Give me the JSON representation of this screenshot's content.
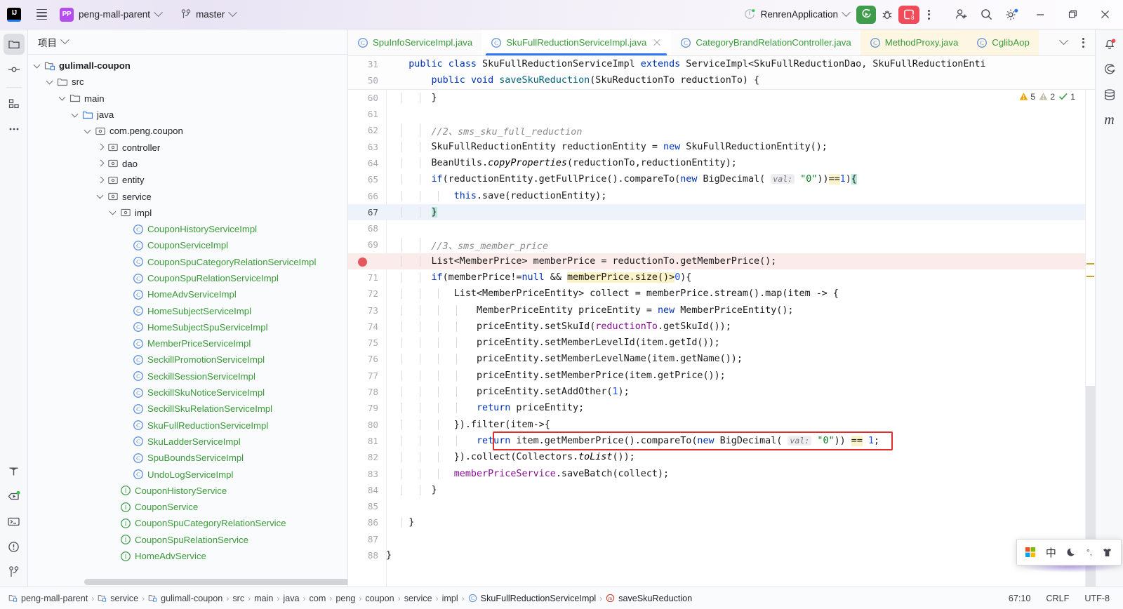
{
  "titlebar": {
    "logo": "IJ",
    "menu_icon": "hamburger-icon",
    "project_badge": "PP",
    "project_name": "peng-mall-parent",
    "branch_icon": "git-branch-icon",
    "branch_name": "master",
    "run_config": "RenrenApplication",
    "run_button": "run-icon",
    "debug_button": "debug-icon",
    "stop_button_count": "8",
    "more_button": "more-options-icon",
    "share_icon": "add-user-icon",
    "search_icon": "search-icon",
    "settings_icon": "gear-icon",
    "minimize": "minimize-icon",
    "maximize": "maximize-icon",
    "close": "close-icon"
  },
  "activitybar": {
    "items": [
      {
        "name": "project-tool-window",
        "icon": "folder-icon",
        "selected": true
      },
      {
        "name": "commit-tool-window",
        "icon": "commit-icon",
        "selected": false
      },
      {
        "name": "structure-tool-window",
        "icon": "structure-icon",
        "selected": false
      },
      {
        "name": "more-tool-windows",
        "icon": "ellipsis-icon",
        "selected": false
      }
    ],
    "bottom_items": [
      {
        "name": "build-tool-window",
        "icon": "hammer-icon"
      },
      {
        "name": "run-tool-window",
        "icon": "run-dashboard-icon"
      },
      {
        "name": "terminal-tool-window",
        "icon": "terminal-icon"
      },
      {
        "name": "problems-tool-window",
        "icon": "problems-icon"
      },
      {
        "name": "version-control-tool-window",
        "icon": "git-branch-icon"
      }
    ]
  },
  "project_panel": {
    "title": "项目",
    "title_chevron": "chevron-down-icon",
    "tree": [
      {
        "depth": 2,
        "label": "gulimall-coupon",
        "icon": "module-icon",
        "arrow": "down",
        "style": "bold"
      },
      {
        "depth": 3,
        "label": "src",
        "icon": "folder-icon",
        "arrow": "down",
        "style": "plain"
      },
      {
        "depth": 4,
        "label": "main",
        "icon": "folder-icon",
        "arrow": "down",
        "style": "plain"
      },
      {
        "depth": 5,
        "label": "java",
        "icon": "source-folder-icon",
        "arrow": "down",
        "style": "plain"
      },
      {
        "depth": 6,
        "label": "com.peng.coupon",
        "icon": "package-icon",
        "arrow": "down",
        "style": "plain"
      },
      {
        "depth": 7,
        "label": "controller",
        "icon": "package-icon",
        "arrow": "right",
        "style": "plain"
      },
      {
        "depth": 7,
        "label": "dao",
        "icon": "package-icon",
        "arrow": "right",
        "style": "plain"
      },
      {
        "depth": 7,
        "label": "entity",
        "icon": "package-icon",
        "arrow": "right",
        "style": "plain"
      },
      {
        "depth": 7,
        "label": "service",
        "icon": "package-icon",
        "arrow": "down",
        "style": "plain"
      },
      {
        "depth": 8,
        "label": "impl",
        "icon": "package-icon",
        "arrow": "down",
        "style": "plain"
      },
      {
        "depth": 9,
        "label": "CouponHistoryServiceImpl",
        "icon": "class-icon",
        "arrow": "none",
        "style": "class"
      },
      {
        "depth": 9,
        "label": "CouponServiceImpl",
        "icon": "class-icon",
        "arrow": "none",
        "style": "class"
      },
      {
        "depth": 9,
        "label": "CouponSpuCategoryRelationServiceImpl",
        "icon": "class-icon",
        "arrow": "none",
        "style": "class"
      },
      {
        "depth": 9,
        "label": "CouponSpuRelationServiceImpl",
        "icon": "class-icon",
        "arrow": "none",
        "style": "class"
      },
      {
        "depth": 9,
        "label": "HomeAdvServiceImpl",
        "icon": "class-icon",
        "arrow": "none",
        "style": "class"
      },
      {
        "depth": 9,
        "label": "HomeSubjectServiceImpl",
        "icon": "class-icon",
        "arrow": "none",
        "style": "class"
      },
      {
        "depth": 9,
        "label": "HomeSubjectSpuServiceImpl",
        "icon": "class-icon",
        "arrow": "none",
        "style": "class"
      },
      {
        "depth": 9,
        "label": "MemberPriceServiceImpl",
        "icon": "class-icon",
        "arrow": "none",
        "style": "class"
      },
      {
        "depth": 9,
        "label": "SeckillPromotionServiceImpl",
        "icon": "class-icon",
        "arrow": "none",
        "style": "class"
      },
      {
        "depth": 9,
        "label": "SeckillSessionServiceImpl",
        "icon": "class-icon",
        "arrow": "none",
        "style": "class"
      },
      {
        "depth": 9,
        "label": "SeckillSkuNoticeServiceImpl",
        "icon": "class-icon",
        "arrow": "none",
        "style": "class"
      },
      {
        "depth": 9,
        "label": "SeckillSkuRelationServiceImpl",
        "icon": "class-icon",
        "arrow": "none",
        "style": "class"
      },
      {
        "depth": 9,
        "label": "SkuFullReductionServiceImpl",
        "icon": "class-icon",
        "arrow": "none",
        "style": "class"
      },
      {
        "depth": 9,
        "label": "SkuLadderServiceImpl",
        "icon": "class-icon",
        "arrow": "none",
        "style": "class"
      },
      {
        "depth": 9,
        "label": "SpuBoundsServiceImpl",
        "icon": "class-icon",
        "arrow": "none",
        "style": "class"
      },
      {
        "depth": 9,
        "label": "UndoLogServiceImpl",
        "icon": "class-icon",
        "arrow": "none",
        "style": "class"
      },
      {
        "depth": 8,
        "label": "CouponHistoryService",
        "icon": "interface-icon",
        "arrow": "none",
        "style": "class"
      },
      {
        "depth": 8,
        "label": "CouponService",
        "icon": "interface-icon",
        "arrow": "none",
        "style": "class"
      },
      {
        "depth": 8,
        "label": "CouponSpuCategoryRelationService",
        "icon": "interface-icon",
        "arrow": "none",
        "style": "class"
      },
      {
        "depth": 8,
        "label": "CouponSpuRelationService",
        "icon": "interface-icon",
        "arrow": "none",
        "style": "class"
      },
      {
        "depth": 8,
        "label": "HomeAdvService",
        "icon": "interface-icon",
        "arrow": "none",
        "style": "class"
      }
    ]
  },
  "tabs": [
    {
      "label": "SpuInfoServiceImpl.java",
      "icon": "class-icon",
      "active": false,
      "warn": false,
      "closable": false
    },
    {
      "label": "SkuFullReductionServiceImpl.java",
      "icon": "class-icon",
      "active": true,
      "warn": false,
      "closable": true
    },
    {
      "label": "CategoryBrandRelationController.java",
      "icon": "class-icon",
      "active": false,
      "warn": false,
      "closable": false
    },
    {
      "label": "MethodProxy.java",
      "icon": "class-icon",
      "active": false,
      "warn": true,
      "closable": false
    },
    {
      "label": "CglibAop",
      "icon": "class-icon",
      "active": false,
      "warn": true,
      "closable": false
    }
  ],
  "tabbar_right": {
    "overflow_icon": "chevron-down-icon",
    "options_icon": "more-options-icon"
  },
  "inspections": {
    "warnings": "5",
    "weak_warnings": "2",
    "ok_count": "1",
    "warning_icon": "warning-triangle-icon",
    "weak_icon": "weak-warning-icon",
    "ok_icon": "inspection-ok-icon",
    "prev_icon": "chevron-up-icon",
    "next_icon": "chevron-down-icon"
  },
  "sticky_lines": [
    {
      "num": "31",
      "indent": 1,
      "tokens": [
        {
          "t": "public",
          "c": "kw"
        },
        {
          "t": " ",
          "c": ""
        },
        {
          "t": "class",
          "c": "kw"
        },
        {
          "t": " SkuFullReductionServiceImpl ",
          "c": ""
        },
        {
          "t": "extends",
          "c": "kw"
        },
        {
          "t": " ServiceImpl<SkuFullReductionDao, SkuFullReductionEnti",
          "c": ""
        }
      ]
    },
    {
      "num": "50",
      "indent": 2,
      "tokens": [
        {
          "t": "public",
          "c": "kw"
        },
        {
          "t": " ",
          "c": ""
        },
        {
          "t": "void",
          "c": "kw"
        },
        {
          "t": " ",
          "c": ""
        },
        {
          "t": "saveSkuReduction",
          "c": "mth"
        },
        {
          "t": "(SkuReductionTo reductionTo) {",
          "c": ""
        }
      ]
    }
  ],
  "code_lines": [
    {
      "num": "60",
      "guides": 2,
      "state": "normal",
      "tokens": [
        {
          "t": "        }",
          "c": ""
        }
      ]
    },
    {
      "num": "61",
      "guides": 2,
      "state": "normal",
      "tokens": [
        {
          "t": "",
          "c": ""
        }
      ]
    },
    {
      "num": "62",
      "guides": 2,
      "state": "normal",
      "tokens": [
        {
          "t": "        //2、sms_sku_full_reduction",
          "c": "cm"
        }
      ]
    },
    {
      "num": "63",
      "guides": 2,
      "state": "normal",
      "tokens": [
        {
          "t": "        SkuFullReductionEntity reductionEntity = ",
          "c": ""
        },
        {
          "t": "new",
          "c": "kw"
        },
        {
          "t": " SkuFullReductionEntity();",
          "c": ""
        }
      ]
    },
    {
      "num": "64",
      "guides": 2,
      "state": "normal",
      "tokens": [
        {
          "t": "        BeanUtils.",
          "c": ""
        },
        {
          "t": "copyProperties",
          "c": "stat"
        },
        {
          "t": "(reductionTo,reductionEntity);",
          "c": ""
        }
      ]
    },
    {
      "num": "65",
      "guides": 2,
      "state": "normal",
      "tokens": [
        {
          "t": "        ",
          "c": ""
        },
        {
          "t": "if",
          "c": "kw"
        },
        {
          "t": "(reductionEntity.getFullPrice().compareTo(",
          "c": ""
        },
        {
          "t": "new",
          "c": "kw"
        },
        {
          "t": " BigDecimal( ",
          "c": ""
        },
        {
          "t": "val:",
          "c": "param"
        },
        {
          "t": " ",
          "c": ""
        },
        {
          "t": "\"0\"",
          "c": "st"
        },
        {
          "t": "))",
          "c": ""
        },
        {
          "t": "==",
          "c": "hl"
        },
        {
          "t": "1",
          "c": "nu"
        },
        {
          "t": ")",
          "c": ""
        },
        {
          "t": "{",
          "c": "hlg"
        }
      ]
    },
    {
      "num": "66",
      "guides": 3,
      "state": "normal",
      "tokens": [
        {
          "t": "            ",
          "c": ""
        },
        {
          "t": "this",
          "c": "kw"
        },
        {
          "t": ".save(reductionEntity);",
          "c": ""
        }
      ]
    },
    {
      "num": "67",
      "guides": 2,
      "state": "cursorline",
      "tokens": [
        {
          "t": "        ",
          "c": ""
        },
        {
          "t": "}",
          "c": "hlg"
        }
      ]
    },
    {
      "num": "68",
      "guides": 2,
      "state": "normal",
      "tokens": [
        {
          "t": "",
          "c": ""
        }
      ]
    },
    {
      "num": "69",
      "guides": 2,
      "state": "normal",
      "tokens": [
        {
          "t": "        //3、sms_member_price",
          "c": "cm"
        }
      ]
    },
    {
      "num": "70",
      "guides": 2,
      "state": "breakpoint",
      "tokens": [
        {
          "t": "        List<MemberPrice> memberPrice = reductionTo.getMemberPrice();",
          "c": ""
        }
      ]
    },
    {
      "num": "71",
      "guides": 2,
      "state": "normal",
      "tokens": [
        {
          "t": "        ",
          "c": ""
        },
        {
          "t": "if",
          "c": "kw"
        },
        {
          "t": "(memberPrice!=",
          "c": ""
        },
        {
          "t": "null",
          "c": "kw"
        },
        {
          "t": " && ",
          "c": ""
        },
        {
          "t": "memberPrice.size()>",
          "c": "hl"
        },
        {
          "t": "0",
          "c": "nu"
        },
        {
          "t": "){",
          "c": ""
        }
      ]
    },
    {
      "num": "72",
      "guides": 3,
      "state": "normal",
      "tokens": [
        {
          "t": "            List<MemberPriceEntity> collect = memberPrice.stream().map(item -> {",
          "c": ""
        }
      ]
    },
    {
      "num": "73",
      "guides": 4,
      "state": "normal",
      "tokens": [
        {
          "t": "                MemberPriceEntity priceEntity = ",
          "c": ""
        },
        {
          "t": "new",
          "c": "kw"
        },
        {
          "t": " MemberPriceEntity();",
          "c": ""
        }
      ]
    },
    {
      "num": "74",
      "guides": 4,
      "state": "normal",
      "tokens": [
        {
          "t": "                priceEntity.setSkuId(",
          "c": ""
        },
        {
          "t": "reductionTo",
          "c": "fld"
        },
        {
          "t": ".getSkuId());",
          "c": ""
        }
      ]
    },
    {
      "num": "75",
      "guides": 4,
      "state": "normal",
      "tokens": [
        {
          "t": "                priceEntity.setMemberLevelId(item.getId());",
          "c": ""
        }
      ]
    },
    {
      "num": "76",
      "guides": 4,
      "state": "normal",
      "tokens": [
        {
          "t": "                priceEntity.setMemberLevelName(item.getName());",
          "c": ""
        }
      ]
    },
    {
      "num": "77",
      "guides": 4,
      "state": "normal",
      "tokens": [
        {
          "t": "                priceEntity.setMemberPrice(item.getPrice());",
          "c": ""
        }
      ]
    },
    {
      "num": "78",
      "guides": 4,
      "state": "normal",
      "tokens": [
        {
          "t": "                priceEntity.setAddOther(",
          "c": ""
        },
        {
          "t": "1",
          "c": "nu"
        },
        {
          "t": ");",
          "c": ""
        }
      ]
    },
    {
      "num": "79",
      "guides": 4,
      "state": "normal",
      "tokens": [
        {
          "t": "                ",
          "c": ""
        },
        {
          "t": "return",
          "c": "kw"
        },
        {
          "t": " priceEntity;",
          "c": ""
        }
      ]
    },
    {
      "num": "80",
      "guides": 3,
      "state": "normal",
      "tokens": [
        {
          "t": "            }).filter(item->{",
          "c": ""
        }
      ]
    },
    {
      "num": "81",
      "guides": 4,
      "state": "normal",
      "tokens": [
        {
          "t": "                ",
          "c": ""
        },
        {
          "t": "return",
          "c": "kw"
        },
        {
          "t": " item.getMemberPrice().compareTo(",
          "c": ""
        },
        {
          "t": "new",
          "c": "kw"
        },
        {
          "t": " BigDecimal( ",
          "c": ""
        },
        {
          "t": "val:",
          "c": "param"
        },
        {
          "t": " ",
          "c": ""
        },
        {
          "t": "\"0\"",
          "c": "st"
        },
        {
          "t": ")) ",
          "c": ""
        },
        {
          "t": "==",
          "c": "hl"
        },
        {
          "t": " ",
          "c": ""
        },
        {
          "t": "1",
          "c": "nu"
        },
        {
          "t": ";",
          "c": ""
        }
      ]
    },
    {
      "num": "82",
      "guides": 3,
      "state": "normal",
      "tokens": [
        {
          "t": "            }).collect(Collectors.",
          "c": ""
        },
        {
          "t": "toList",
          "c": "stat"
        },
        {
          "t": "());",
          "c": ""
        }
      ]
    },
    {
      "num": "83",
      "guides": 3,
      "state": "normal",
      "tokens": [
        {
          "t": "            ",
          "c": ""
        },
        {
          "t": "memberPriceService",
          "c": "fld"
        },
        {
          "t": ".saveBatch(collect);",
          "c": ""
        }
      ]
    },
    {
      "num": "84",
      "guides": 2,
      "state": "normal",
      "tokens": [
        {
          "t": "        }",
          "c": ""
        }
      ]
    },
    {
      "num": "85",
      "guides": 2,
      "state": "normal",
      "tokens": [
        {
          "t": "",
          "c": ""
        }
      ]
    },
    {
      "num": "86",
      "guides": 1,
      "state": "normal",
      "tokens": [
        {
          "t": "    }",
          "c": ""
        }
      ]
    },
    {
      "num": "87",
      "guides": 1,
      "state": "normal",
      "tokens": [
        {
          "t": "",
          "c": ""
        }
      ]
    },
    {
      "num": "88",
      "guides": 0,
      "state": "normal",
      "tokens": [
        {
          "t": "}",
          "c": ""
        }
      ]
    }
  ],
  "annotation": {
    "name": "red-highlight-box",
    "line": "81"
  },
  "rightbar": {
    "items": [
      {
        "name": "notifications-tool-window",
        "icon": "bell-icon",
        "badge": true
      },
      {
        "name": "spring-tool-window",
        "icon": "spring-icon",
        "badge": false
      },
      {
        "name": "database-tool-window",
        "icon": "database-icon",
        "badge": false
      },
      {
        "name": "maven-tool-window",
        "icon": "maven-icon",
        "badge": false
      }
    ]
  },
  "statusbar": {
    "breadcrumbs": [
      {
        "label": "peng-mall-parent",
        "icon": "module-icon"
      },
      {
        "label": "service",
        "icon": "module-icon"
      },
      {
        "label": "gulimall-coupon",
        "icon": "module-icon"
      },
      {
        "label": "src",
        "icon": "none"
      },
      {
        "label": "main",
        "icon": "none"
      },
      {
        "label": "java",
        "icon": "none"
      },
      {
        "label": "com",
        "icon": "none"
      },
      {
        "label": "peng",
        "icon": "none"
      },
      {
        "label": "coupon",
        "icon": "none"
      },
      {
        "label": "service",
        "icon": "none"
      },
      {
        "label": "impl",
        "icon": "none"
      },
      {
        "label": "SkuFullReductionServiceImpl",
        "icon": "class-icon"
      },
      {
        "label": "saveSkuReduction",
        "icon": "method-icon"
      }
    ],
    "caret_position": "67:10",
    "line_separator": "CRLF",
    "encoding": "UTF-8"
  },
  "ime_widget": {
    "items": [
      "windows-logo-icon",
      "chinese-mode-label",
      "moon-icon",
      "punctuation-icon",
      "tools-icon"
    ],
    "chinese_label": "中"
  }
}
